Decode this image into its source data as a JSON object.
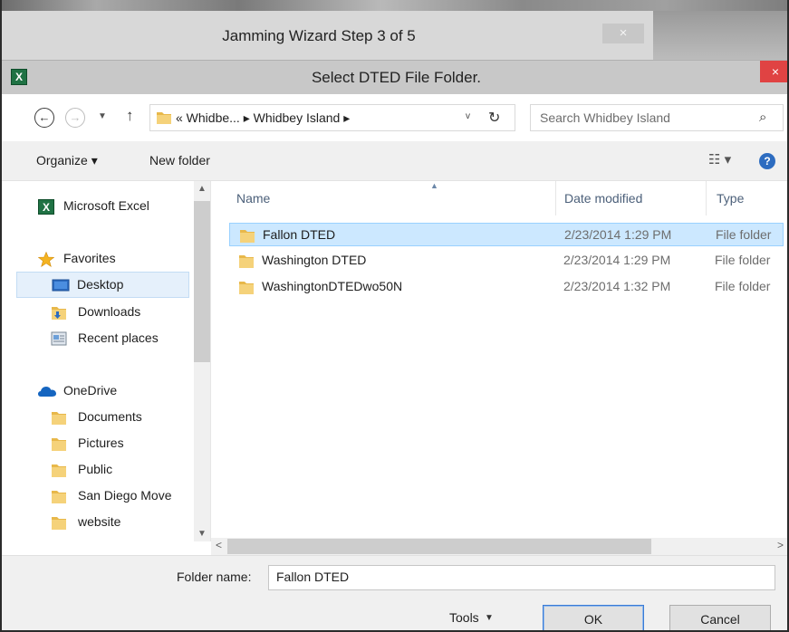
{
  "wizard": {
    "title": "Jamming Wizard Step 3 of 5",
    "close_label": "×"
  },
  "dialog": {
    "title": "Select DTED File Folder.",
    "app_icon_letter": "X",
    "close_label": "×"
  },
  "address": {
    "back_label": "←",
    "forward_label": "→",
    "up_label": "↑",
    "path": "« Whidbe... ▸ Whidbey Island ▸",
    "dropdown_label": "v",
    "refresh_label": "↻",
    "search_placeholder": "Search Whidbey Island",
    "search_icon": "⌕"
  },
  "toolbar": {
    "organize_label": "Organize ▾",
    "new_folder_label": "New folder",
    "view_label": "☷ ▾",
    "help_label": "?"
  },
  "nav": {
    "items": [
      {
        "label": "Microsoft Excel",
        "icon": "excel-icon"
      },
      {
        "label": "Favorites",
        "icon": "star-icon"
      },
      {
        "label": "Desktop",
        "icon": "desktop-icon",
        "selected": true
      },
      {
        "label": "Downloads",
        "icon": "downloads-icon"
      },
      {
        "label": "Recent places",
        "icon": "recent-places-icon"
      },
      {
        "label": "OneDrive",
        "icon": "onedrive-icon"
      },
      {
        "label": "Documents",
        "icon": "folder-icon"
      },
      {
        "label": "Pictures",
        "icon": "folder-icon"
      },
      {
        "label": "Public",
        "icon": "folder-icon"
      },
      {
        "label": "San Diego Move",
        "icon": "folder-icon"
      },
      {
        "label": "website",
        "icon": "folder-icon"
      }
    ]
  },
  "file_list": {
    "columns": [
      "Name",
      "Date modified",
      "Type"
    ],
    "rows": [
      {
        "name": "Fallon DTED",
        "date": "2/23/2014 1:29 PM",
        "type": "File folder",
        "selected": true
      },
      {
        "name": "Washington DTED",
        "date": "2/23/2014 1:29 PM",
        "type": "File folder"
      },
      {
        "name": "WashingtonDTEDwo50N",
        "date": "2/23/2014 1:32 PM",
        "type": "File folder"
      }
    ]
  },
  "footer": {
    "folder_name_label": "Folder name:",
    "folder_name_value": "Fallon DTED",
    "tools_label": "Tools",
    "ok_label": "OK",
    "cancel_label": "Cancel"
  },
  "colors": {
    "selection": "#cce8ff",
    "accent": "#3a7bd5",
    "close_red": "#e04343",
    "excel_green": "#1f7244",
    "folder_yellow": "#e8b84a"
  }
}
